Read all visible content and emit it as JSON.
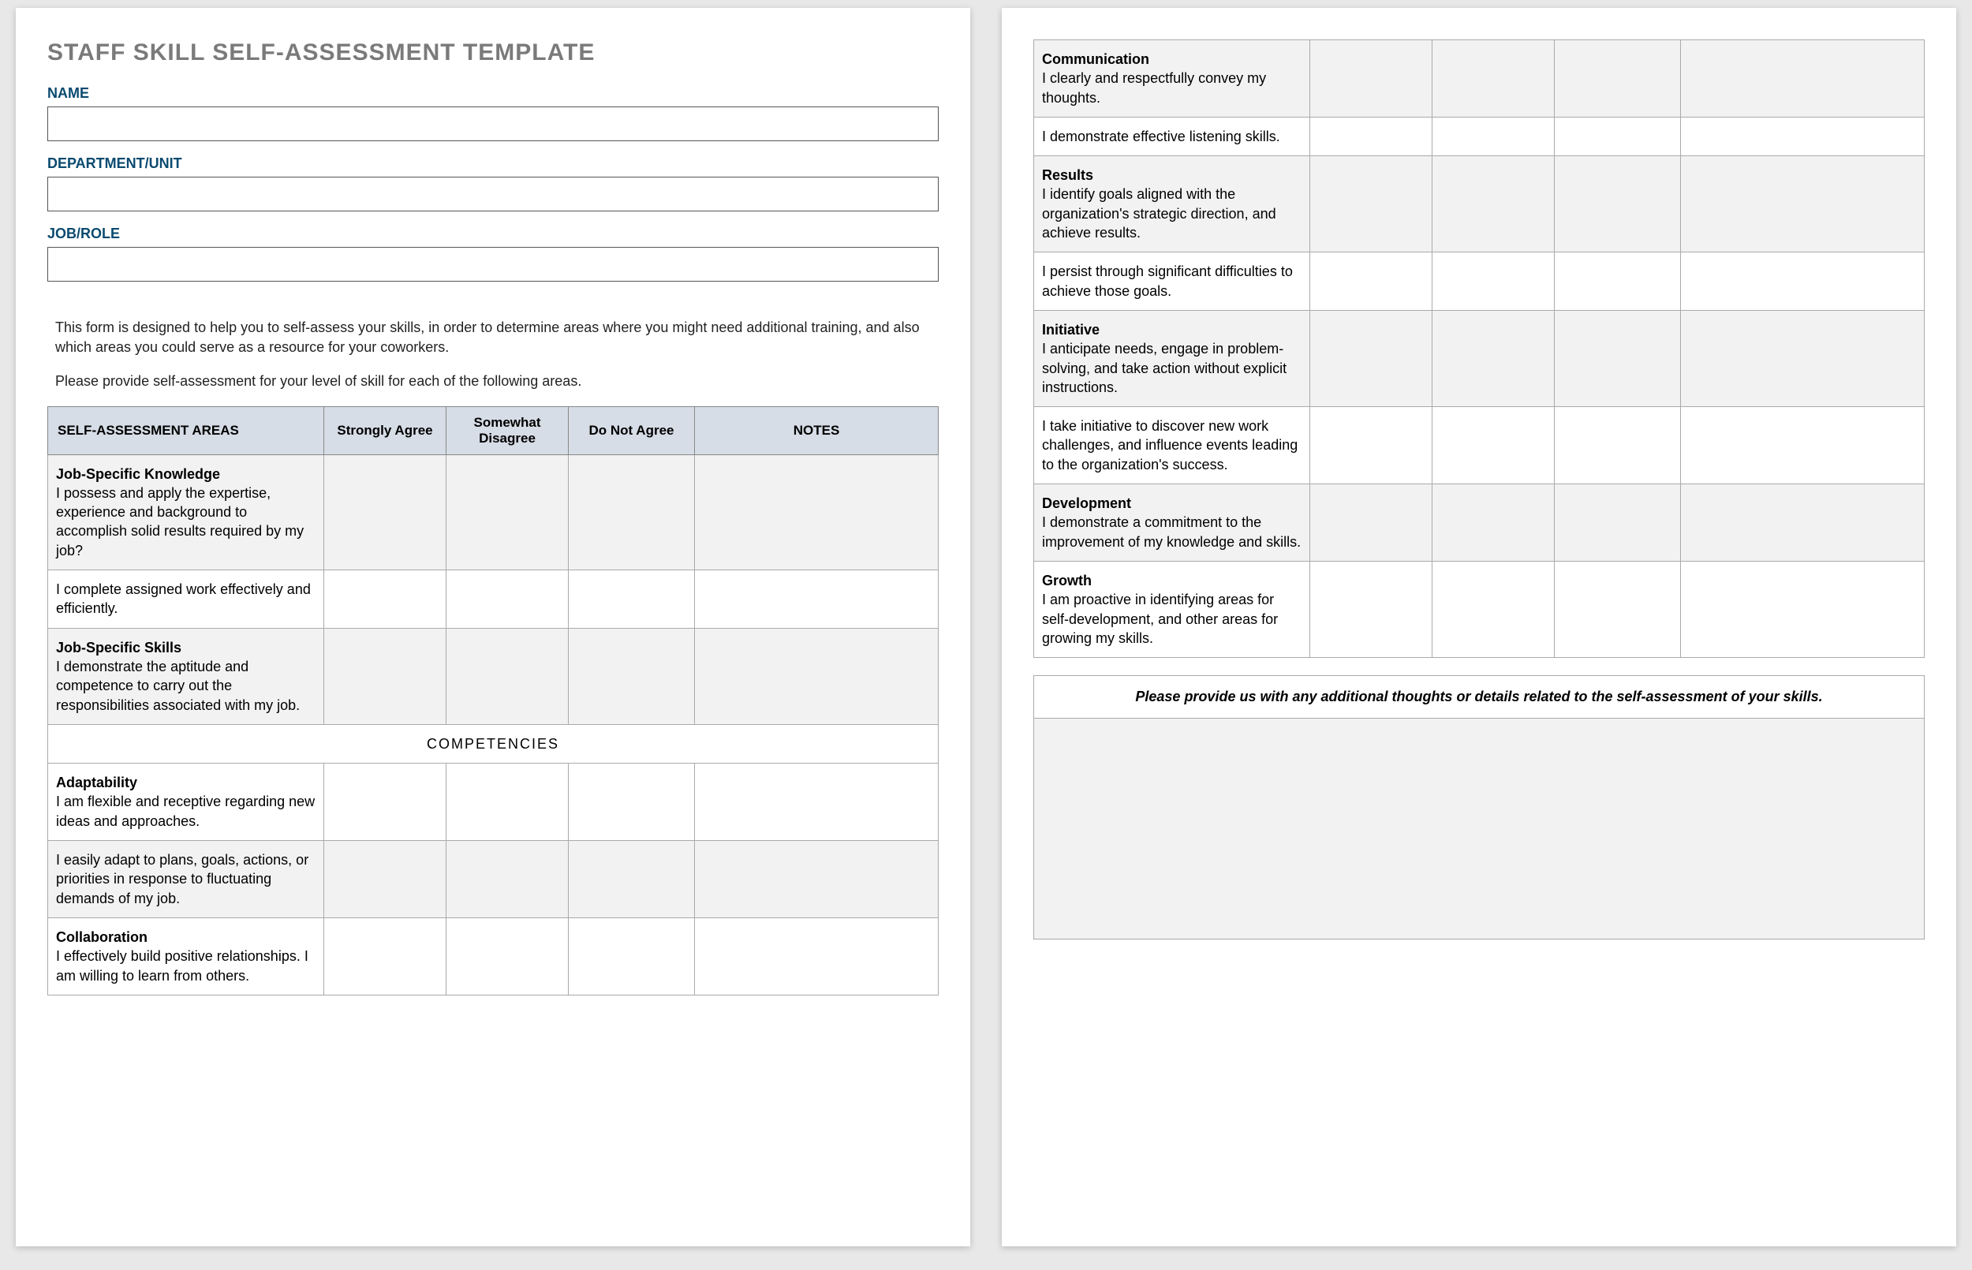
{
  "title": "STAFF SKILL SELF-ASSESSMENT TEMPLATE",
  "fields": {
    "name_label": "NAME",
    "dept_label": "DEPARTMENT/UNIT",
    "job_label": "JOB/ROLE",
    "name_value": "",
    "dept_value": "",
    "job_value": ""
  },
  "intro1": "This form is designed to help you to self-assess your skills, in order to determine areas where you might need additional training, and also which areas you could serve as a resource for your coworkers.",
  "intro2": "Please provide self-assessment for your level of skill for each of the following areas.",
  "headers": {
    "areas": "SELF-ASSESSMENT AREAS",
    "strongly": "Strongly Agree",
    "somewhat": "Somewhat Disagree",
    "donot": "Do Not Agree",
    "notes": "NOTES"
  },
  "competencies_heading": "COMPETENCIES",
  "rows_p1": [
    {
      "title": "Job-Specific Knowledge",
      "desc": "I possess and apply the expertise, experience and background to accomplish solid results required by my job?",
      "shaded": true
    },
    {
      "title": "",
      "desc": "I complete assigned work effectively and efficiently.",
      "shaded": false
    },
    {
      "title": "Job-Specific Skills",
      "desc": "I demonstrate the aptitude and competence to carry out the responsibilities associated with my job.",
      "shaded": true
    }
  ],
  "rows_p1b": [
    {
      "title": "Adaptability",
      "desc": "I am flexible and receptive regarding new ideas and approaches.",
      "shaded": false
    },
    {
      "title": "",
      "desc": "I easily adapt to plans, goals, actions, or priorities in response to fluctuating demands of my job.",
      "shaded": true
    },
    {
      "title": "Collaboration",
      "desc": "I effectively build positive relationships. I am willing to learn from others.",
      "shaded": false
    }
  ],
  "rows_p2": [
    {
      "title": "Communication",
      "desc": "I clearly and respectfully convey my thoughts.",
      "shaded": true
    },
    {
      "title": "",
      "desc": "I demonstrate effective listening skills.",
      "shaded": false
    },
    {
      "title": "Results",
      "desc": "I identify goals aligned with the organization's strategic direction, and achieve results.",
      "shaded": true
    },
    {
      "title": "",
      "desc": "I persist through significant difficulties to achieve those goals.",
      "shaded": false
    },
    {
      "title": "Initiative",
      "desc": "I anticipate needs, engage in problem-solving, and take action without explicit instructions.",
      "shaded": true
    },
    {
      "title": "",
      "desc": "I take initiative to discover new work challenges, and influence events leading to the organization's success.",
      "shaded": false
    },
    {
      "title": "Development",
      "desc": "I demonstrate a commitment to the improvement of my knowledge and skills.",
      "shaded": true
    },
    {
      "title": "Growth",
      "desc": "I am proactive in identifying areas for self-development, and other areas for growing my skills.",
      "shaded": false
    }
  ],
  "feedback_prompt": "Please provide us with any additional thoughts or details related to the self-assessment of your skills.",
  "feedback_value": ""
}
